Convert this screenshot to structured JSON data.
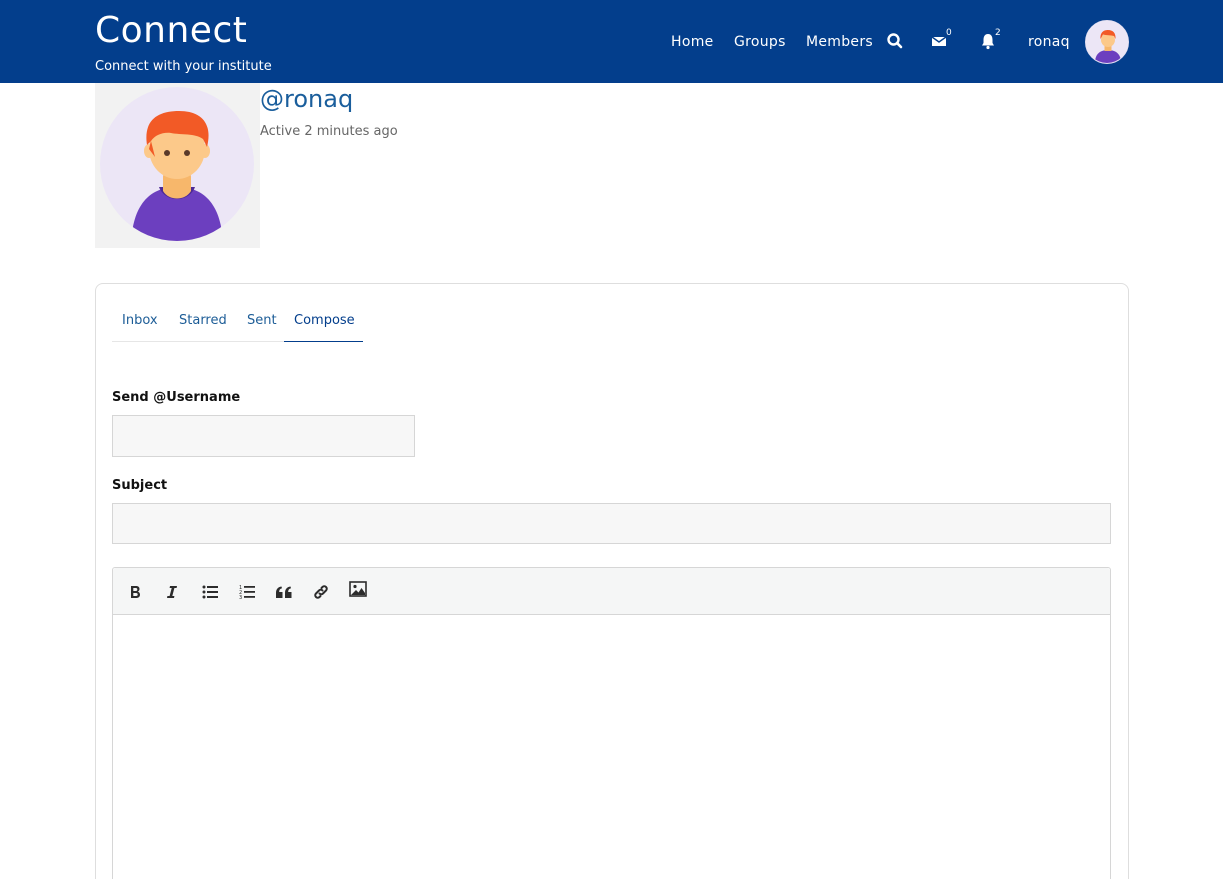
{
  "brand": {
    "title": "Connect",
    "subtitle": "Connect with your institute"
  },
  "nav": {
    "links": [
      "Home",
      "Groups",
      "Members"
    ],
    "messages_count": "0",
    "notifications_count": "2",
    "username": "ronaq"
  },
  "profile": {
    "handle": "@ronaq",
    "last_active": "Active 2 minutes ago"
  },
  "tabs": [
    "Inbox",
    "Starred",
    "Sent",
    "Compose"
  ],
  "active_tab": "Compose",
  "compose": {
    "username_label": "Send @Username",
    "username_value": "",
    "subject_label": "Subject",
    "subject_value": ""
  },
  "editor": {
    "tools": [
      "bold-icon",
      "italic-icon",
      "bullet-list-icon",
      "numbered-list-icon",
      "quote-icon",
      "link-icon",
      "image-icon"
    ]
  },
  "colors": {
    "header_bg": "#033e8c",
    "link": "#1d5d97",
    "avatar_bg": "#ece6f6",
    "avatar_hair": "#f25a26",
    "avatar_shirt": "#6c3fbf"
  }
}
